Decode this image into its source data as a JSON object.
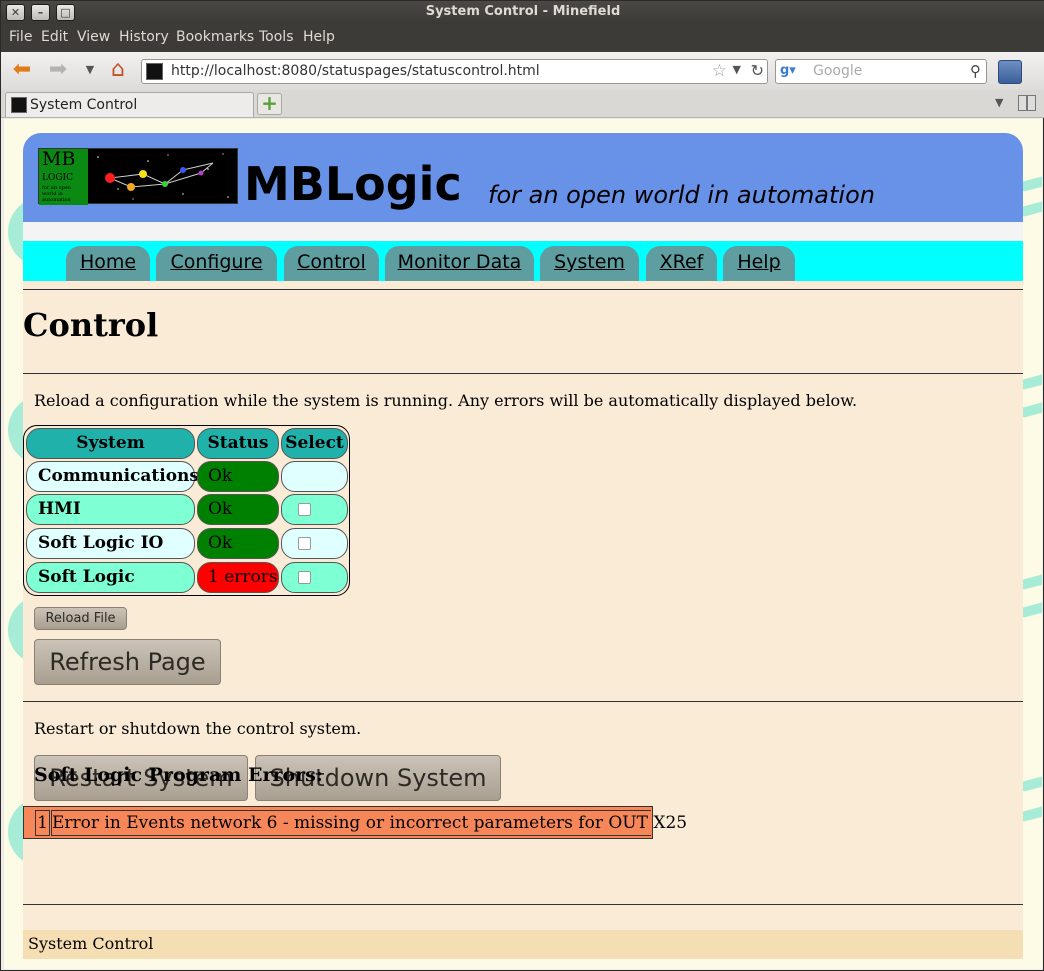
{
  "window": {
    "title": "System Control - Minefield"
  },
  "menubar": [
    {
      "label": "File"
    },
    {
      "label": "Edit"
    },
    {
      "label": "View"
    },
    {
      "label": "History"
    },
    {
      "label": "Bookmarks"
    },
    {
      "label": "Tools"
    },
    {
      "label": "Help"
    }
  ],
  "navbar": {
    "url": "http://localhost:8080/statuspages/statuscontrol.html",
    "search_placeholder": "Google"
  },
  "tabs": [
    {
      "label": "System Control"
    }
  ],
  "site": {
    "logo_text": "MB",
    "logo_sub": "LOGIC",
    "logo_tiny": "for an open world in automation",
    "title": "MBLogic",
    "tagline": "for an open world in automation"
  },
  "nav": [
    {
      "label": "Home"
    },
    {
      "label": "Configure"
    },
    {
      "label": "Control"
    },
    {
      "label": "Monitor Data"
    },
    {
      "label": "System"
    },
    {
      "label": "XRef"
    },
    {
      "label": "Help"
    }
  ],
  "main": {
    "title": "Control",
    "intro": "Reload a configuration while the system is running. Any errors will be automatically displayed below.",
    "table": {
      "headers": [
        "System",
        "Status",
        "Select"
      ],
      "rows": [
        {
          "system": "Communications",
          "status": "Ok",
          "status_color": "#008000",
          "name_color": "#e0ffff",
          "select_color": "#e0ffff",
          "has_checkbox": false
        },
        {
          "system": "HMI",
          "status": "Ok",
          "status_color": "#008000",
          "name_color": "#7fffd4",
          "select_color": "#7fffd4",
          "has_checkbox": true
        },
        {
          "system": "Soft Logic IO",
          "status": "Ok",
          "status_color": "#008000",
          "name_color": "#e0ffff",
          "select_color": "#e0ffff",
          "has_checkbox": true
        },
        {
          "system": "Soft Logic",
          "status": "1 errors",
          "status_color": "#ff0000",
          "name_color": "#7fffd4",
          "select_color": "#7fffd4",
          "has_checkbox": true
        }
      ]
    },
    "reload_button": "Reload File",
    "refresh_button": "Refresh Page",
    "restart_text": "Restart or shutdown the control system.",
    "restart_button": "Restart System",
    "shutdown_button": "Shutdown System",
    "errors_title": "Soft Logic Program Errors:",
    "errors": [
      {
        "num": "1",
        "message": "Error in Events network 6 - missing or incorrect parameters for OUT X25"
      }
    ]
  },
  "footer": {
    "text": "System Control"
  }
}
